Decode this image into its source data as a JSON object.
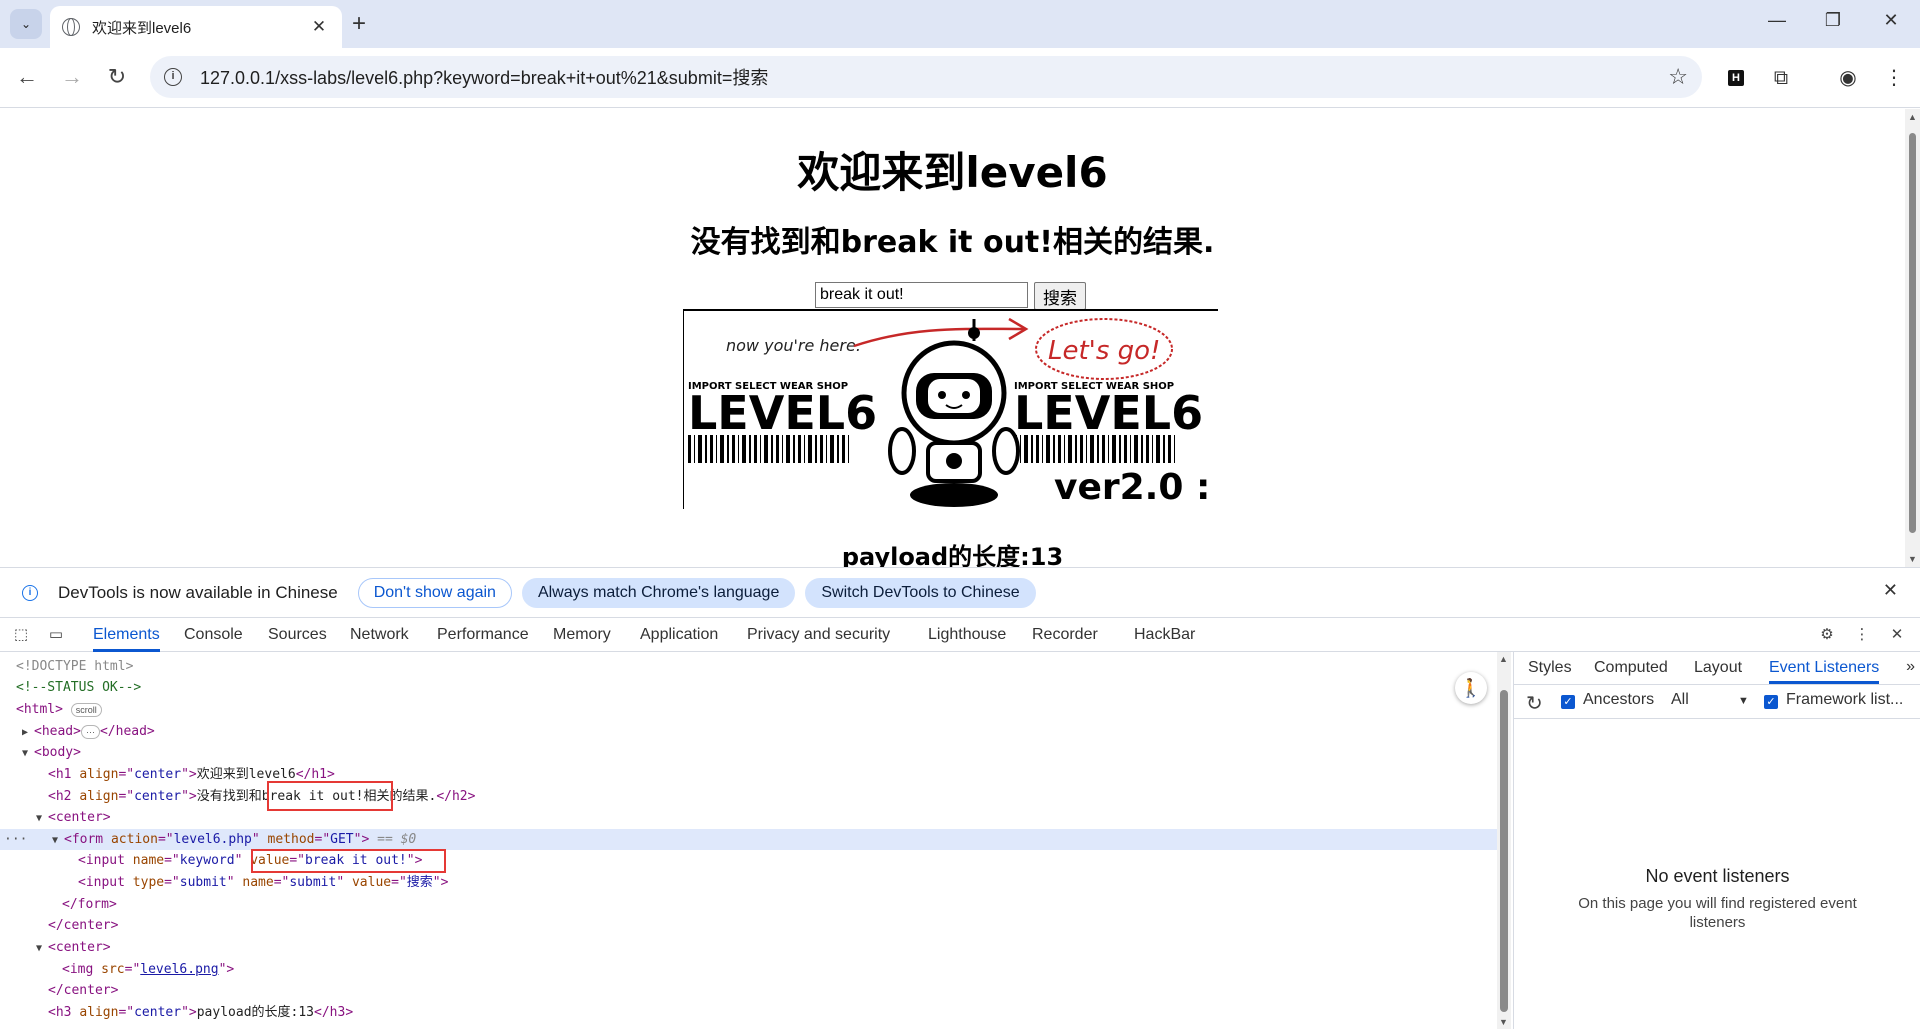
{
  "browser": {
    "tab_title": "欢迎来到level6",
    "url": "127.0.0.1/xss-labs/level6.php?keyword=break+it+out%21&submit=搜索"
  },
  "page": {
    "h1": "欢迎来到level6",
    "h2": "没有找到和break it out!相关的结果.",
    "keyword_value": "break it out!",
    "submit_label": "搜索",
    "h3": "payload的长度:13",
    "image": {
      "note_text": "now you're here.",
      "bubble_text": "Let's go!",
      "shop_text": "IMPORT SELECT WEAR SHOP",
      "level_text": "LEVEL6",
      "version_text": "ver2.0 :"
    }
  },
  "infobar": {
    "message": "DevTools is now available in Chinese",
    "btn_dont_show": "Don't show again",
    "btn_always_match": "Always match Chrome's language",
    "btn_switch": "Switch DevTools to Chinese"
  },
  "devtools": {
    "tabs": [
      "Elements",
      "Console",
      "Sources",
      "Network",
      "Performance",
      "Memory",
      "Application",
      "Privacy and security",
      "Lighthouse",
      "Recorder",
      "HackBar"
    ],
    "dom": {
      "doctype": "<!DOCTYPE html>",
      "comment": "<!--STATUS OK-->",
      "html_open": "<html>",
      "scroll_badge": "scroll",
      "head": "<head>",
      "head_close": "</head>",
      "ellipsis": "···",
      "body_open": "<body>",
      "h1_text": "欢迎来到level6",
      "h2_prefix": "没有找到",
      "h2_mid": "和break it out!",
      "h2_suffix": "相关的结果.",
      "center": "center",
      "form_action": "level6.php",
      "form_method": "GET",
      "selected_marker": "== $0",
      "input1_name": "keyword",
      "input1_value": "break it out!",
      "input2_type": "submit",
      "input2_name": "submit",
      "input2_value": "搜索",
      "img_src": "level6.png",
      "h3_text": "payload的长度:13",
      "row_dots": "···"
    },
    "sidebar": {
      "tabs": [
        "Styles",
        "Computed",
        "Layout",
        "Event Listeners"
      ],
      "ancestors_label": "Ancestors",
      "filter_value": "All",
      "framework_label": "Framework list...",
      "empty_title": "No event listeners",
      "empty_desc": "On this page you will find registered event listeners"
    }
  }
}
